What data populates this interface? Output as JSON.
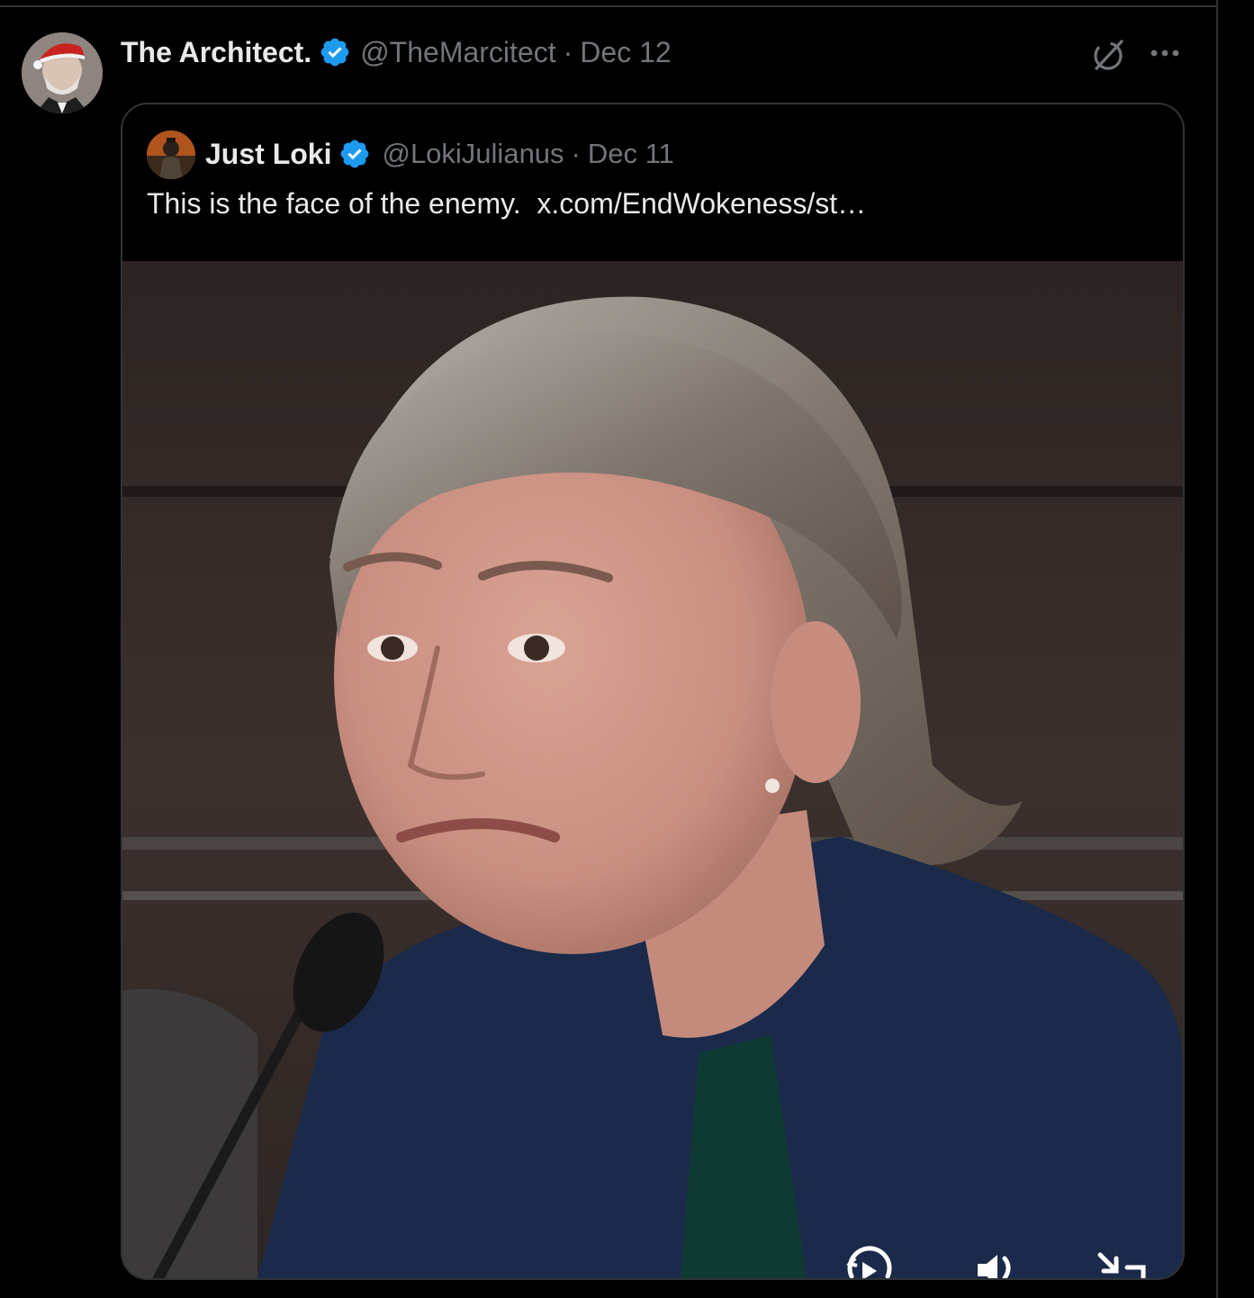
{
  "tweet": {
    "author": {
      "display_name": "The Architect.",
      "handle": "@TheMarcitect",
      "verified": true,
      "avatar_icon": "user-avatar-santa-hat"
    },
    "separator": "·",
    "date": "Dec 12",
    "actions": {
      "grok_icon": "grok-icon",
      "more_icon": "more-options-icon"
    }
  },
  "quoted_tweet": {
    "author": {
      "display_name": "Just Loki",
      "handle": "@LokiJulianus",
      "verified": true,
      "avatar_icon": "user-avatar"
    },
    "separator": "·",
    "date": "Dec 11",
    "text": "This is the face of the enemy.",
    "link_text": "x.com/EndWokeness/st…",
    "media": {
      "type": "video",
      "controls": {
        "replay_icon": "replay-icon",
        "volume_icon": "volume-icon",
        "minimize_icon": "minimize-icon"
      }
    }
  },
  "colors": {
    "background": "#000000",
    "text_primary": "#e7e9ea",
    "text_secondary": "#71767b",
    "border": "#2f3336",
    "verified_blue": "#1d9bf0"
  }
}
